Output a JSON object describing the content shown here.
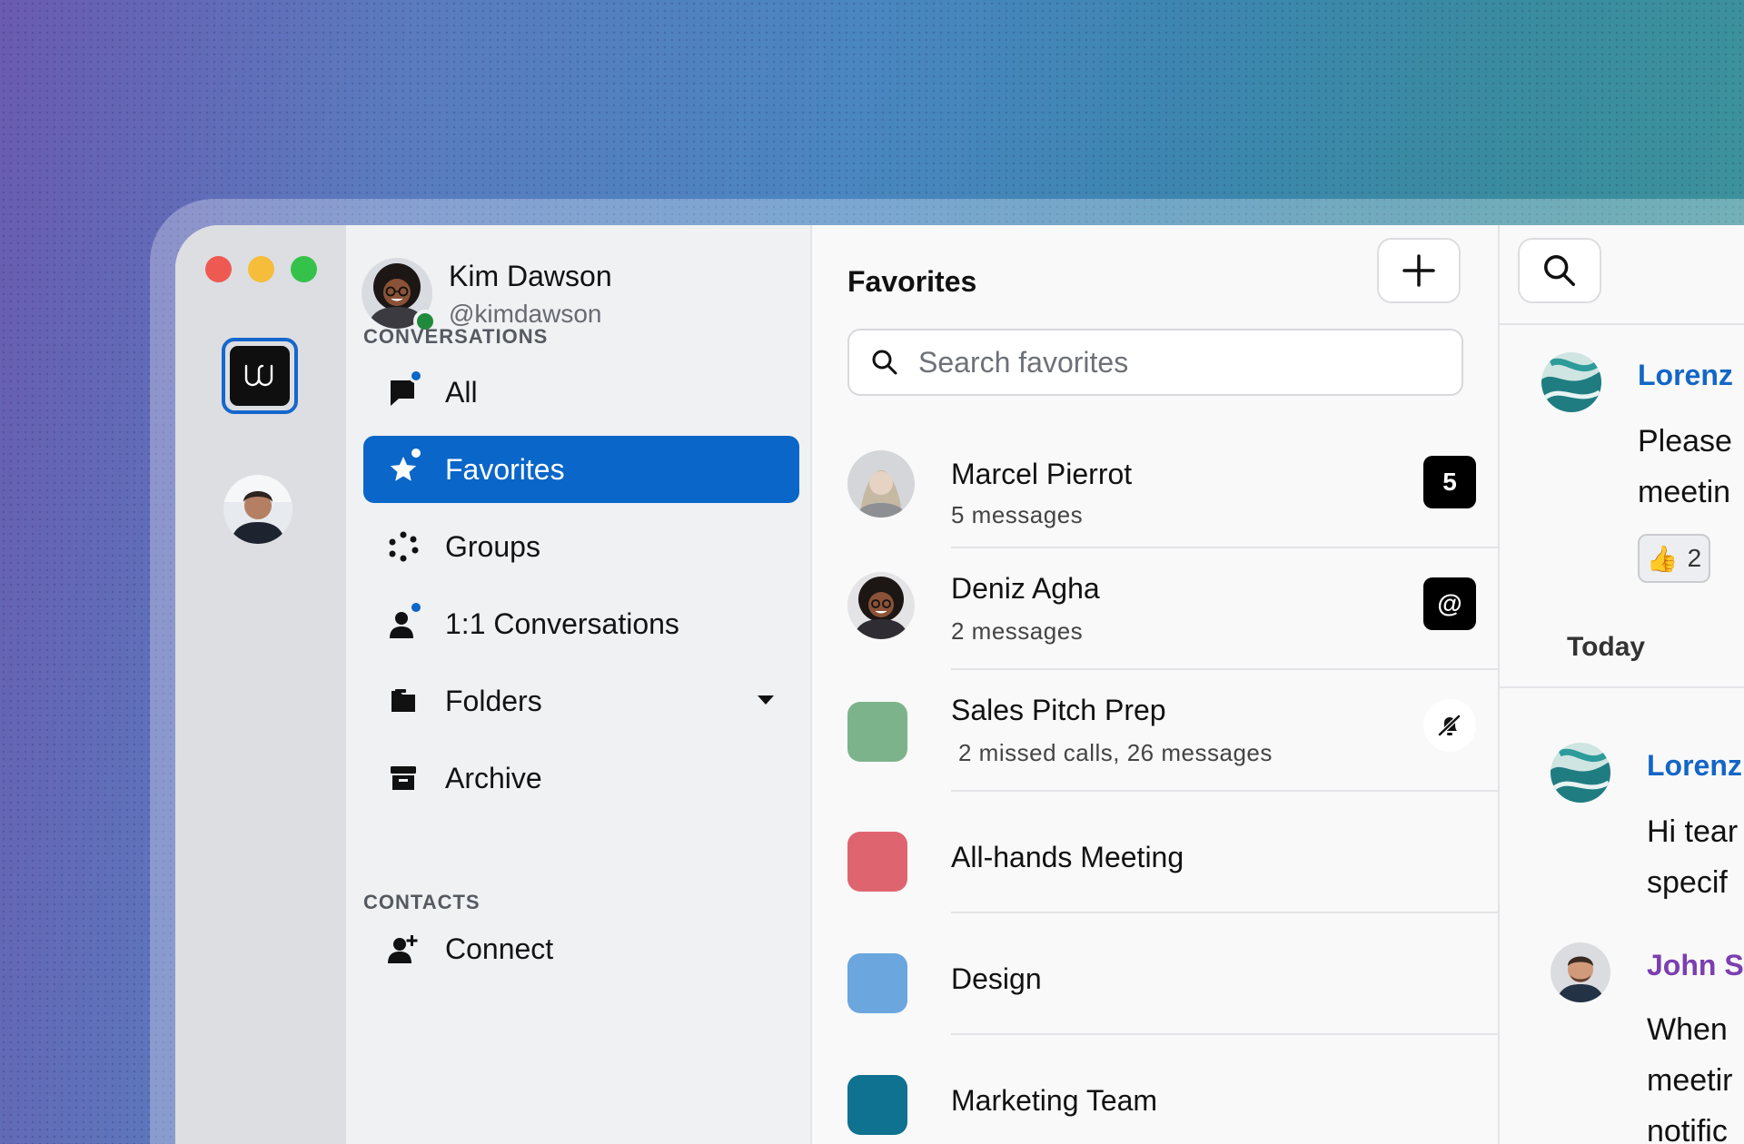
{
  "user": {
    "name": "Kim Dawson",
    "handle": "@kimdawson",
    "status_color": "#1f8a3c"
  },
  "sidebar": {
    "conversations_label": "CONVERSATIONS",
    "contacts_label": "CONTACTS",
    "items": [
      {
        "label": "All",
        "icon": "speech-bubble-icon",
        "unread": true
      },
      {
        "label": "Favorites",
        "icon": "star-icon",
        "unread": true,
        "active": true
      },
      {
        "label": "Groups",
        "icon": "groups-icon"
      },
      {
        "label": "1:1 Conversations",
        "icon": "person-icon",
        "unread": true
      },
      {
        "label": "Folders",
        "icon": "folder-icon",
        "expandable": true
      },
      {
        "label": "Archive",
        "icon": "archive-icon"
      }
    ],
    "contacts_items": [
      {
        "label": "Connect",
        "icon": "add-person-icon"
      }
    ]
  },
  "list": {
    "title": "Favorites",
    "search_placeholder": "Search favorites",
    "rows": [
      {
        "title": "Marcel Pierrot",
        "subtitle": "5 messages",
        "badge": "5"
      },
      {
        "title": "Deniz Agha",
        "subtitle": "2 messages",
        "badge": "@"
      },
      {
        "title": "Sales Pitch Prep",
        "subtitle": "2 missed calls, 26 messages",
        "color": "#7db38a",
        "badge_icon": "muted-bell-icon"
      },
      {
        "title": "All-hands Meeting",
        "color": "#de6570"
      },
      {
        "title": "Design",
        "color": "#6ba6de"
      },
      {
        "title": "Marketing Team",
        "color": "#0e7290"
      }
    ]
  },
  "chat": {
    "messages": [
      {
        "sender": "Lorenz",
        "sender_color": "#1366c6",
        "lines": "Please\nmeetin"
      },
      {
        "sender": "Lorenz",
        "sender_color": "#1366c6",
        "lines": "Hi tear\nspecif"
      },
      {
        "sender": "John S",
        "sender_color": "#7b3fb0",
        "lines": "When \nmeetir\nnotific"
      }
    ],
    "reaction": {
      "emoji": "👍",
      "count": "2"
    },
    "day_label": "Today"
  },
  "colors": {
    "accent": "#0a66c8",
    "background_gradient_start": "#6a5ab0",
    "background_gradient_end": "#3f969b"
  }
}
